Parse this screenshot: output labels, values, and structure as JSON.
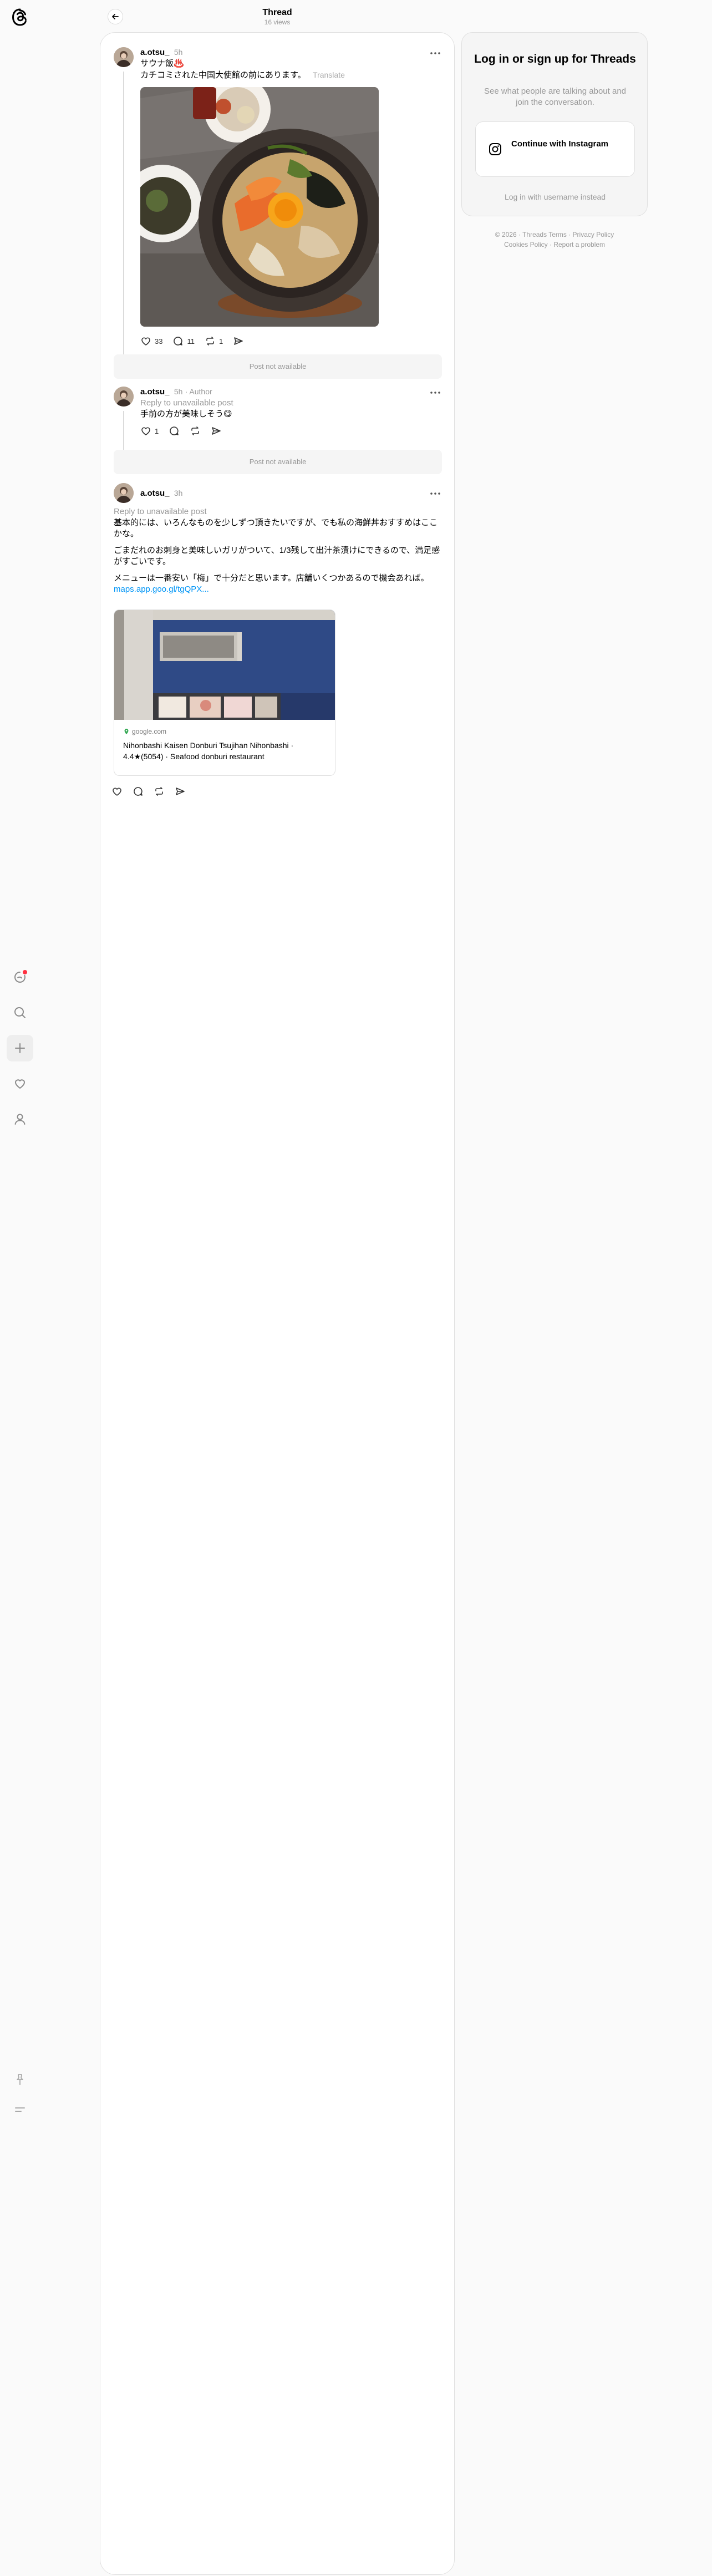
{
  "header": {
    "title": "Thread",
    "views": "16 views"
  },
  "sidebar": {
    "items": [
      {
        "icon": "threads-home-icon",
        "active": false
      },
      {
        "icon": "search-icon",
        "active": false
      },
      {
        "icon": "plus-icon",
        "active": true
      },
      {
        "icon": "heart-icon",
        "active": false
      },
      {
        "icon": "profile-icon",
        "active": false
      }
    ],
    "bottom": [
      "pin-icon",
      "menu-icon"
    ]
  },
  "posts": [
    {
      "username": "a.otsu_",
      "time": "5h",
      "lines": [
        "サウナ飯♨️",
        "カチコミされた中国大使館の前にあります。"
      ],
      "translate": "Translate",
      "likes": "33",
      "replies": "11",
      "reposts": "1"
    },
    {
      "username": "a.otsu_",
      "time": "5h",
      "author_tag": "Author",
      "reply_to": "Reply to unavailable post",
      "text": "手前の方が美味しそう😋",
      "likes": "1"
    },
    {
      "username": "a.otsu_",
      "time": "3h",
      "reply_to": "Reply to unavailable post",
      "paragraphs": [
        "基本的には、いろんなものを少しずつ頂きたいですが、でも私の海鮮丼おすすめはここかな。",
        "ごまだれのお刺身と美味しいガリがついて、1/3残して出汁茶漬けにできるので、満足感がすごいです。",
        "メニューは一番安い「梅」で十分だと思います。店舗いくつかあるので機会あれば。"
      ],
      "link_text": "maps.app.goo.gl/tgQPX...",
      "card": {
        "domain": "google.com",
        "title": "Nihonbashi Kaisen Donburi Tsujihan Nihonbashi · 4.4★(5054) · Seafood donburi restaurant"
      }
    }
  ],
  "unavailable": [
    "Post not available",
    "Post not available"
  ],
  "login": {
    "title": "Log in or sign up for Threads",
    "subtitle": "See what people are talking about and join the conversation.",
    "button": "Continue with Instagram",
    "alt": "Log in with username instead"
  },
  "footer": {
    "line1": "© 2026 · Threads Terms · Privacy Policy",
    "line2": "Cookies Policy · Report a problem"
  },
  "colors": {
    "accent_link": "#0095f6",
    "notification_dot": "#ff3040"
  }
}
